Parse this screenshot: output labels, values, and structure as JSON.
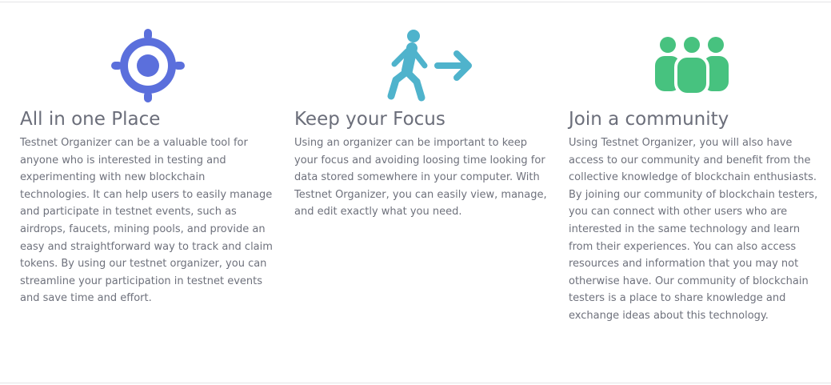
{
  "features": [
    {
      "icon": "crosshair-target-icon",
      "title": "All in one Place",
      "description": "Testnet Organizer can be a valuable tool for anyone who is interested in testing and experimenting with new blockchain technologies. It can help users to easily manage and participate in testnet events, such as airdrops, faucets, mining pools, and provide an easy and straightforward way to track and claim tokens. By using our testnet organizer, you can streamline your participation in testnet events and save time and effort."
    },
    {
      "icon": "person-walking-arrow-right-icon",
      "title": "Keep your Focus",
      "description": "Using an organizer can be important to keep your focus and avoiding loosing time looking for data stored somewhere in your computer. With Testnet Organizer, you can easily view, manage, and edit exactly what you need."
    },
    {
      "icon": "people-group-icon",
      "title": "Join a community",
      "description": "Using Testnet Organizer, you will also have access to our community and benefit from the collective knowledge of blockchain enthusiasts. By joining our community of blockchain testers, you can connect with other users who are interested in the same technology and learn from their experiences. You can also access resources and information that you may not otherwise have. Our community of blockchain testers is a place to share knowledge and exchange ideas about this technology."
    }
  ],
  "colors": {
    "target_icon": "#5b6fdc",
    "walking_icon": "#4fb3cc",
    "community_icon": "#47c27f",
    "heading": "#6b6e7a",
    "body_text": "#6e717c"
  }
}
